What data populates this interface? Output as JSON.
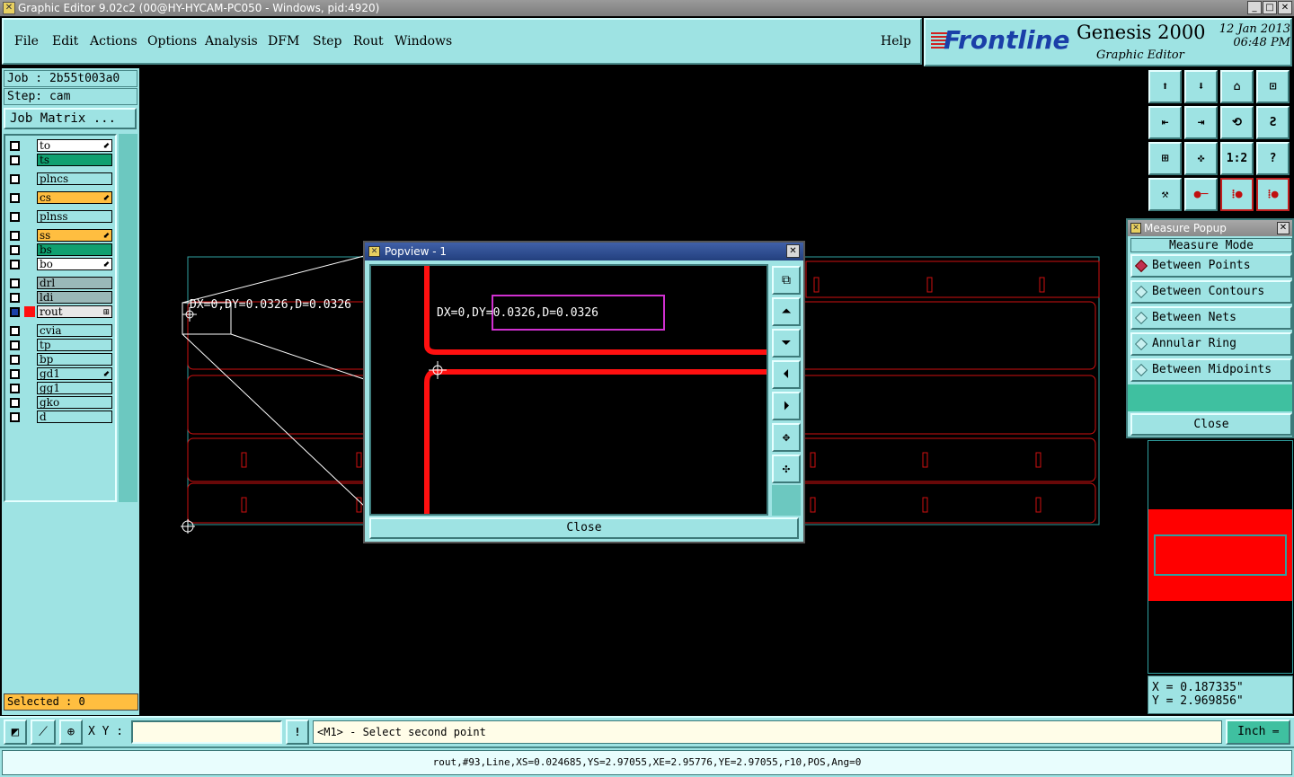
{
  "window": {
    "title": "Graphic Editor 9.02c2 (00@HY-HYCAM-PC050 - Windows, pid:4920)"
  },
  "menu": {
    "file": "File",
    "edit": "Edit",
    "actions": "Actions",
    "options": "Options",
    "analysis": "Analysis",
    "dfm": "DFM",
    "step": "Step",
    "rout": "Rout",
    "windows": "Windows",
    "help": "Help"
  },
  "brand": {
    "logo": "Frontline",
    "product": "Genesis 2000",
    "subtitle": "Graphic Editor",
    "date": "12 Jan 2013",
    "time": "06:48 PM"
  },
  "job": {
    "job_line": "Job : 2b55t003a0",
    "step_line": "Step: cam",
    "matrix_button": "Job Matrix ..."
  },
  "layers": [
    {
      "name": "to",
      "color": "#ffffff",
      "arrow": "⬋"
    },
    {
      "name": "ts",
      "color": "#10a070",
      "arrow": ""
    },
    {
      "name": "plncs",
      "color": "#9ee3e3",
      "arrow": ""
    },
    {
      "name": "cs",
      "color": "#ffbe40",
      "arrow": "⬋"
    },
    {
      "name": "plnss",
      "color": "#9ee3e3",
      "arrow": ""
    },
    {
      "name": "ss",
      "color": "#ffbe40",
      "arrow": "⬋"
    },
    {
      "name": "bs",
      "color": "#10a070",
      "arrow": ""
    },
    {
      "name": "bo",
      "color": "#ffffff",
      "arrow": "⬋"
    },
    {
      "name": "drl",
      "color": "#9ab8b8",
      "arrow": ""
    },
    {
      "name": "ldi",
      "color": "#9ab8b8",
      "arrow": ""
    },
    {
      "name": "rout",
      "color": "#e8e8e8",
      "arrow": "⊞"
    },
    {
      "name": "cvia",
      "color": "#9ee3e3",
      "arrow": ""
    },
    {
      "name": "tp",
      "color": "#9ee3e3",
      "arrow": ""
    },
    {
      "name": "bp",
      "color": "#9ee3e3",
      "arrow": ""
    },
    {
      "name": "gd1",
      "color": "#9ee3e3",
      "arrow": "⬋"
    },
    {
      "name": "gg1",
      "color": "#9ee3e3",
      "arrow": ""
    },
    {
      "name": "gko",
      "color": "#9ee3e3",
      "arrow": ""
    },
    {
      "name": "d",
      "color": "#9ee3e3",
      "arrow": ""
    }
  ],
  "selected": "Selected : 0",
  "canvas": {
    "measure_text": "DX=0,DY=0.0326,D=0.0326"
  },
  "popview": {
    "title": "Popview - 1",
    "readout": "DX=0,DY=0.0326,D=0.0326",
    "close": "Close"
  },
  "measure": {
    "title": "Measure Popup",
    "mode_label": "Measure Mode",
    "options": [
      "Between Points",
      "Between Contours",
      "Between Nets",
      "Annular Ring",
      "Between Midpoints"
    ],
    "selected": 0,
    "close": "Close"
  },
  "tools": {
    "ratio_label": "1:2",
    "help_label": "?"
  },
  "coords": {
    "x": "X = 0.187335\"",
    "y": "Y = 2.969856\""
  },
  "status": {
    "xy_label": "X Y :",
    "xy_value": "",
    "prompt": "<M1> - Select second point",
    "unit": "Inch"
  },
  "bottom": {
    "info": "rout,#93,Line,XS=0.024685,YS=2.97055,XE=2.95776,YE=2.97055,r10,POS,Ang=0"
  }
}
